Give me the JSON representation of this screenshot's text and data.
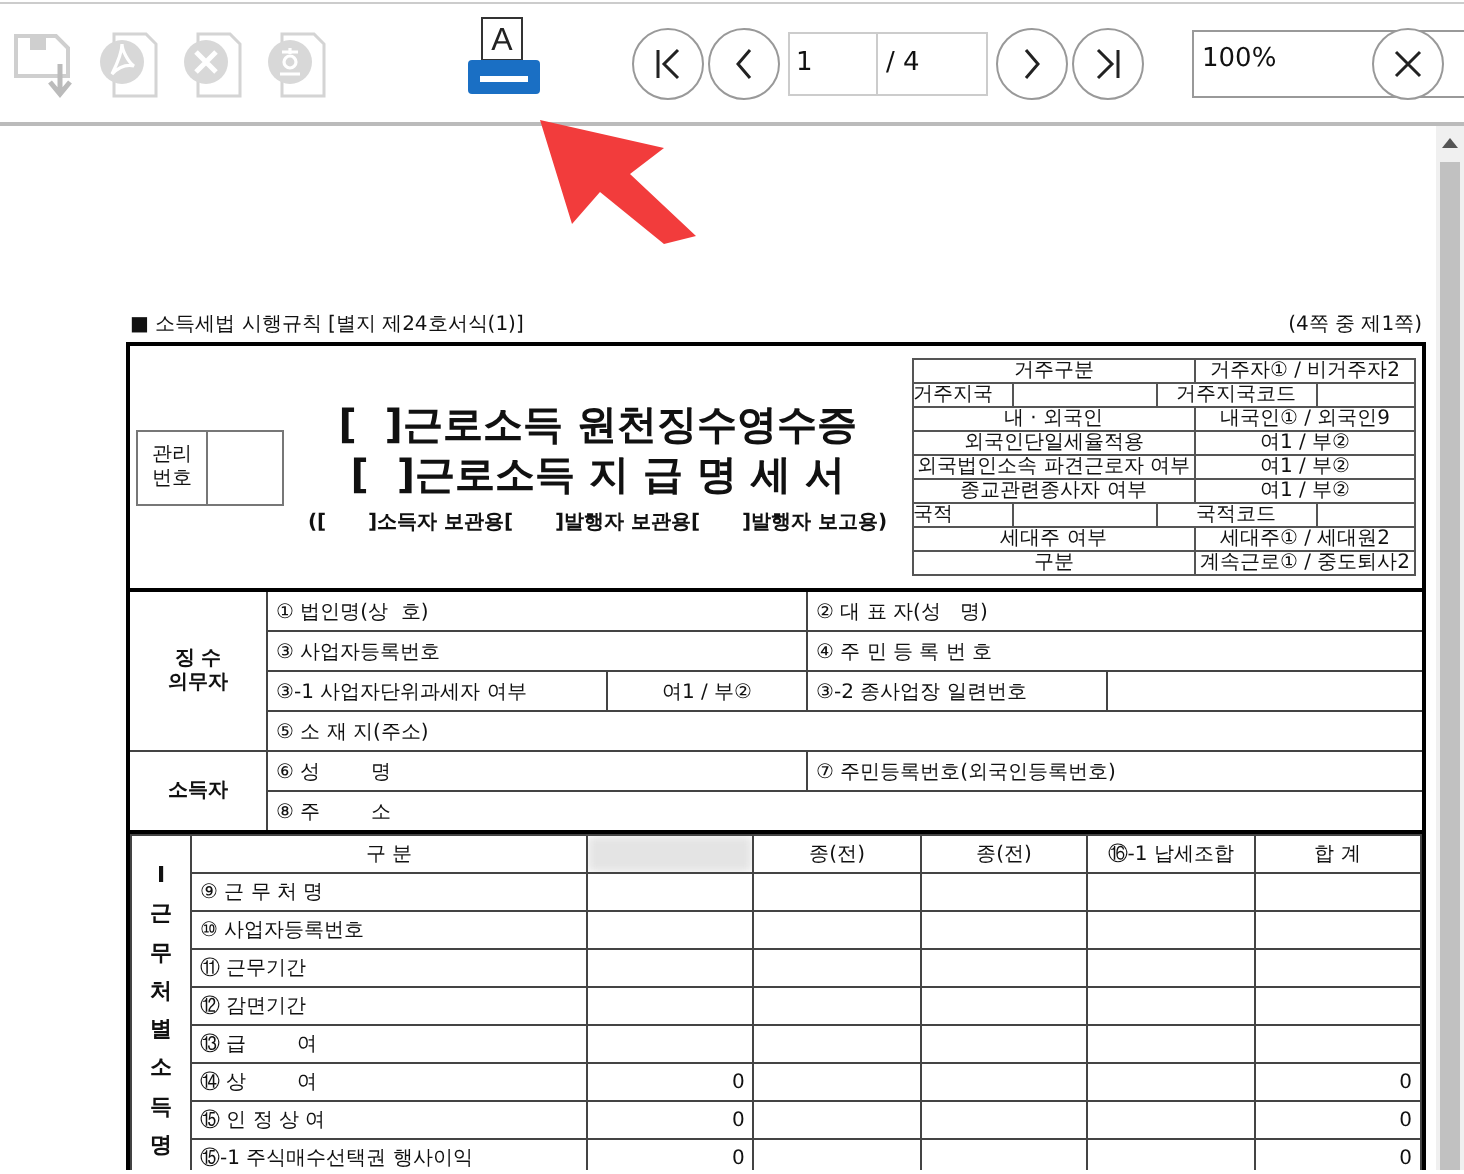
{
  "toolbar": {
    "file_actions": [
      {
        "kind": "save",
        "disabled": true
      },
      {
        "kind": "pdf",
        "disabled": true
      },
      {
        "kind": "excel",
        "disabled": true
      },
      {
        "kind": "hwp",
        "disabled": true
      }
    ],
    "print_glyph": "A",
    "pager": {
      "page": "1",
      "total": "/ 4"
    },
    "zoom": {
      "value": "100%"
    }
  },
  "form": {
    "regulation": "■ 소득세법 시행규칙 [별지 제24호서식(1)]",
    "page_note": "(4쪽 중 제1쪽)",
    "management_label": "관리\n번호",
    "titles": [
      "[  ]근로소득 원천징수영수증",
      "[  ]근로소득 지 급 명 세 서"
    ],
    "copies": "([      ]소득자 보관용[      ]발행자 보관용[      ]발행자 보고용)",
    "residency": [
      {
        "kind": "pair",
        "cells": [
          "거주구분",
          "거주자① / 비거주자2"
        ]
      },
      {
        "kind": "split",
        "cells": [
          "거주지국",
          "거주지국코드"
        ]
      },
      {
        "kind": "pair",
        "cells": [
          "내 · 외국인",
          "내국인① / 외국인9"
        ]
      },
      {
        "kind": "wide",
        "cells": [
          "외국인단일세율적용",
          "여1 / 부②"
        ]
      },
      {
        "kind": "wide",
        "cells": [
          "외국법인소속 파견근로자 여부",
          "여1 / 부②"
        ]
      },
      {
        "kind": "wide",
        "cells": [
          "종교관련종사자 여부",
          "여1 / 부②"
        ]
      },
      {
        "kind": "split",
        "cells": [
          "국적",
          "국적코드"
        ]
      },
      {
        "kind": "pair",
        "cells": [
          "세대주 여부",
          "세대주① / 세대원2"
        ]
      },
      {
        "kind": "pair",
        "cells": [
          "구분",
          "계속근로① / 중도퇴사2"
        ]
      }
    ],
    "parties": [
      {
        "label": "징 수\n의무자",
        "rows": [
          {
            "kind": "halves",
            "cells": [
              "① 법인명(상  호)",
              "② 대 표 자(성   명)"
            ]
          },
          {
            "kind": "halves",
            "cells": [
              "③ 사업자등록번호",
              "④ 주 민 등 록 번 호"
            ]
          },
          {
            "kind": "quarters",
            "cells": [
              "③-1 사업자단위과세자 여부",
              "여1 / 부②",
              "③-2 종사업장 일련번호"
            ]
          },
          {
            "kind": "full",
            "cells": [
              "⑤ 소 재 지(주소)"
            ]
          }
        ]
      },
      {
        "label": "소득자",
        "rows": [
          {
            "kind": "halves",
            "cells": [
              "⑥ 성        명",
              "⑦ 주민등록번호(외국인등록번호)"
            ]
          },
          {
            "kind": "full",
            "cells": [
              "⑧ 주        소"
            ]
          }
        ]
      }
    ],
    "income": {
      "section_label": "I근무처별소득명",
      "columns": [
        {
          "label": "구 분"
        },
        {
          "redacted": true
        },
        {
          "label": "종(전)"
        },
        {
          "label": "종(전)"
        },
        {
          "label": "⑯-1 납세조합"
        },
        {
          "label": "합 계"
        }
      ],
      "rows": [
        {
          "label": "⑨ 근 무 처 명"
        },
        {
          "label": "⑩ 사업자등록번호"
        },
        {
          "label": "⑪ 근무기간"
        },
        {
          "label": "⑫ 감면기간"
        },
        {
          "label": "⑬ 급        여"
        },
        {
          "label": "⑭ 상        여",
          "amount": "0",
          "total": "0"
        },
        {
          "label": "⑮ 인 정 상 여",
          "amount": "0",
          "total": "0"
        },
        {
          "label": "⑮-1 주식매수선택권 행사이익",
          "amount": "0",
          "total": "0"
        }
      ]
    }
  }
}
